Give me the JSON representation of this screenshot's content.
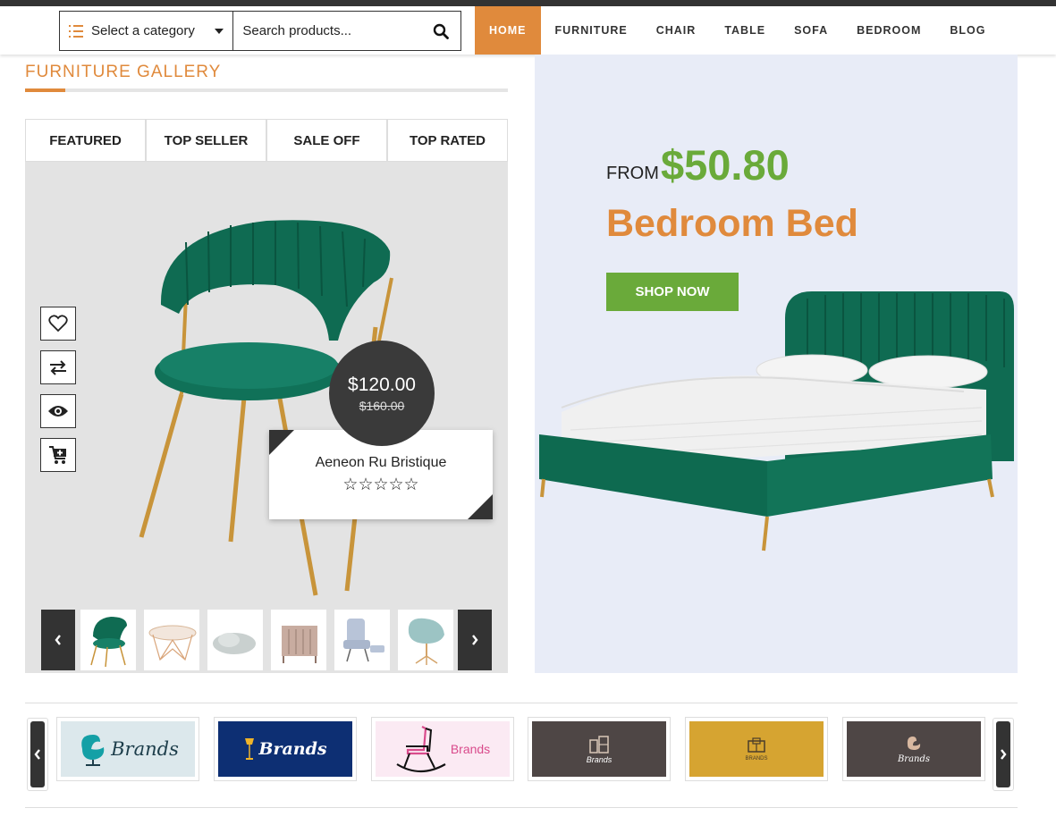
{
  "header": {
    "category_label": "Select a category",
    "search_placeholder": "Search products...",
    "nav": [
      "HOME",
      "FURNITURE",
      "CHAIR",
      "TABLE",
      "SOFA",
      "BEDROOM",
      "BLOG"
    ]
  },
  "gallery": {
    "title": "FURNITURE GALLERY",
    "tabs": [
      "FEATURED",
      "TOP SELLER",
      "SALE OFF",
      "TOP RATED"
    ],
    "product": {
      "price": "$120.00",
      "old_price": "$160.00",
      "name": "Aeneon Ru Bristique",
      "rating": 0,
      "stars": "☆☆☆☆☆"
    },
    "actions": [
      "heart-icon",
      "compare-icon",
      "eye-icon",
      "cart-plus-icon"
    ]
  },
  "banner": {
    "from_label": "FROM",
    "price": "$50.80",
    "headline": "Bedroom Bed",
    "button_label": "SHOP NOW"
  },
  "brands": [
    {
      "label": "Brands",
      "bg": "#dce8ec",
      "fg": "#1c3d4a"
    },
    {
      "label": "Brands",
      "bg": "#0d2f73",
      "fg": "#ffffff"
    },
    {
      "label": "Brands",
      "bg": "#fbeaf3",
      "fg": "#d94b8c"
    },
    {
      "label": "Brands",
      "bg": "#4e4645",
      "fg": "#ffffff"
    },
    {
      "label": "BRANDS",
      "bg": "#d6a431",
      "fg": "#4a3d2a"
    },
    {
      "label": "Brands",
      "bg": "#4e4645",
      "fg": "#ffffff"
    }
  ],
  "colors": {
    "accent": "#e08a3c",
    "green": "#6aaa3a",
    "dark": "#333333"
  }
}
